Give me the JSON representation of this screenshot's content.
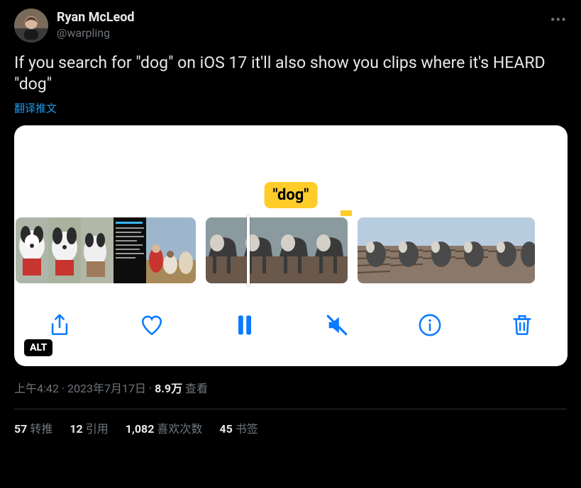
{
  "header": {
    "display_name": "Ryan McLeod",
    "handle": "@warpling"
  },
  "body": {
    "text": "If you search for \"dog\" on iOS 17 it'll also show you clips where it's HEARD \"dog\"",
    "translate_label": "翻译推文"
  },
  "media": {
    "keyword_label": "\"dog\"",
    "alt_badge": "ALT"
  },
  "meta": {
    "time": "上午4:42",
    "sep1": " · ",
    "date": "2023年7月17日",
    "sep2": " · ",
    "views_count": "8.9万",
    "views_label": " 查看"
  },
  "stats": {
    "retweets_n": "57",
    "retweets_l": "转推",
    "quotes_n": "12",
    "quotes_l": "引用",
    "likes_n": "1,082",
    "likes_l": "喜欢次数",
    "bookmarks_n": "45",
    "bookmarks_l": "书签"
  }
}
